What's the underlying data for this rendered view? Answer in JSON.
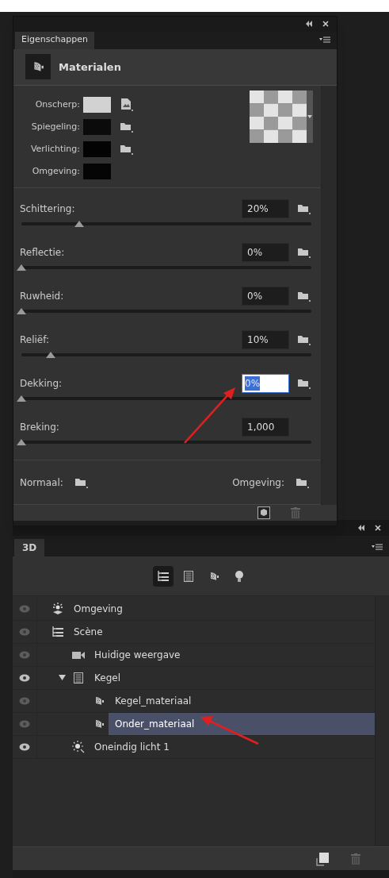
{
  "properties_panel": {
    "tab": {
      "label": "Eigenschappen",
      "selected": true
    },
    "header": {
      "title": "Materialen"
    },
    "channels": [
      {
        "label": "Onscherp:",
        "color": "#d2d2d2",
        "kind": "texture"
      },
      {
        "label": "Spiegeling:",
        "color": "#0b0b0b",
        "kind": "folder"
      },
      {
        "label": "Verlichting:",
        "color": "#030303",
        "kind": "folder"
      },
      {
        "label": "Omgeving:",
        "color": "#050505",
        "kind": "plain"
      }
    ],
    "sliders": [
      {
        "label": "Schittering:",
        "value": "20%",
        "level": 0.2,
        "focused": false,
        "kind": "folder"
      },
      {
        "label": "Reflectie:",
        "value": "0%",
        "level": 0,
        "focused": false,
        "kind": "folder"
      },
      {
        "label": "Ruwheid:",
        "value": "0%",
        "level": 0,
        "focused": false,
        "kind": "folder"
      },
      {
        "label": "Reliëf:",
        "value": "10%",
        "level": 0.1,
        "focused": false,
        "kind": "folder"
      },
      {
        "label": "Dekking:",
        "value": "0%",
        "level": 0,
        "focused": true,
        "kind": "folder"
      },
      {
        "label": "Breking:",
        "value": "1,000",
        "level": 0,
        "focused": false,
        "kind": "plain"
      }
    ],
    "maps": [
      {
        "label": "Normaal:"
      },
      {
        "label": "Omgeving:"
      }
    ]
  },
  "scene_panel": {
    "tab": {
      "label": "3D",
      "selected": true
    },
    "filters": [
      {
        "kind": "scene",
        "selected": true
      },
      {
        "kind": "mesh",
        "selected": false
      },
      {
        "kind": "material",
        "selected": false
      },
      {
        "kind": "light",
        "selected": false
      }
    ],
    "tree": [
      {
        "label": "Omgeving",
        "kind": "environment",
        "visible": false,
        "selected": false
      },
      {
        "label": "Scène",
        "kind": "scene",
        "visible": false,
        "selected": false,
        "children": [
          {
            "label": "Huidige weergave",
            "kind": "camera",
            "visible": false,
            "selected": false
          },
          {
            "label": "Kegel",
            "kind": "mesh",
            "visible": true,
            "selected": false,
            "expanded": true,
            "children": [
              {
                "label": "Kegel_materiaal",
                "kind": "material",
                "visible": false,
                "selected": false
              },
              {
                "label": "Onder_materiaal",
                "kind": "material",
                "visible": false,
                "selected": true
              }
            ]
          },
          {
            "label": "Oneindig licht 1",
            "kind": "light",
            "visible": true,
            "selected": false
          }
        ]
      }
    ]
  }
}
